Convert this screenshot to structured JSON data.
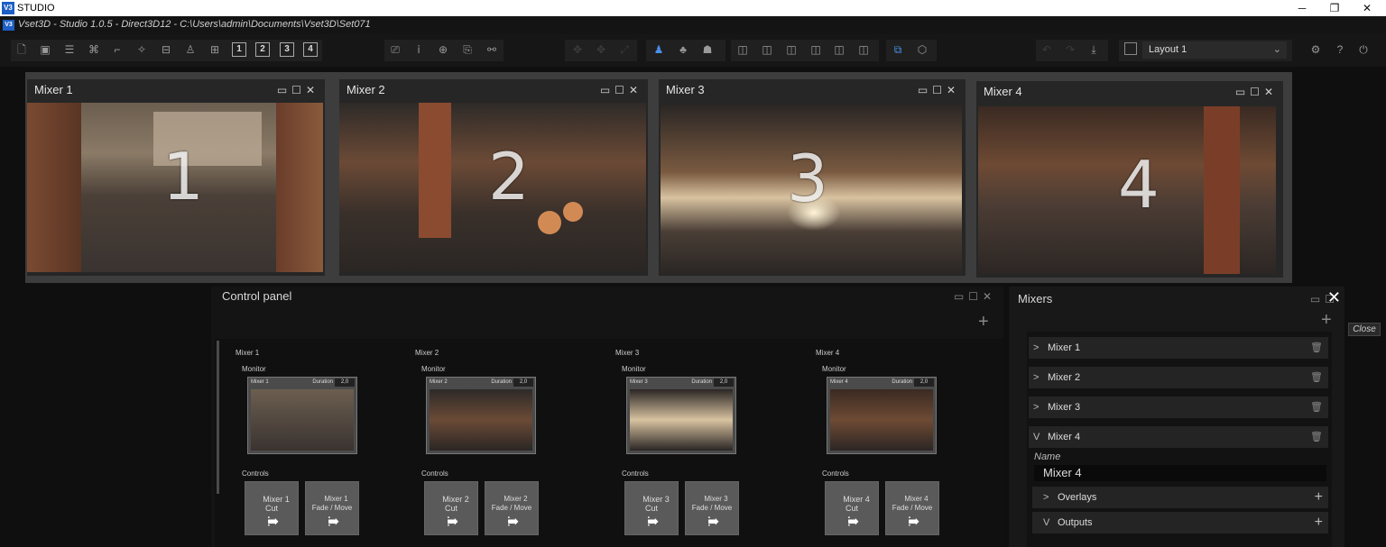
{
  "os_window": {
    "logo": "V3",
    "title": "STUDIO",
    "minimize": "─",
    "restore": "❐",
    "close": "✕"
  },
  "app": {
    "logo": "V3",
    "title": "Vset3D - Studio 1.0.5 - Direct3D12 - C:\\Users\\admin\\Documents\\Vset3D\\Set071"
  },
  "toolbar": {
    "layout_button": "Layout 1",
    "numbers": [
      "1",
      "2",
      "3",
      "4"
    ]
  },
  "mixer_windows": [
    {
      "title": "Mixer 1",
      "number": "1"
    },
    {
      "title": "Mixer 2",
      "number": "2"
    },
    {
      "title": "Mixer 3",
      "number": "3"
    },
    {
      "title": "Mixer 4",
      "number": "4"
    }
  ],
  "control_panel": {
    "title": "Control panel",
    "mixers": [
      {
        "name": "Mixer 1",
        "monitor_label": "Monitor",
        "monitor_name": "Mixer 1",
        "duration_label": "Duration",
        "duration": "2,0",
        "controls_label": "Controls",
        "cut": "Mixer 1\nCut",
        "fade": "Mixer 1\nFade / Move"
      },
      {
        "name": "Mixer 2",
        "monitor_label": "Monitor",
        "monitor_name": "Mixer 2",
        "duration_label": "Duration",
        "duration": "2,0",
        "controls_label": "Controls",
        "cut": "Mixer 2\nCut",
        "fade": "Mixer 2\nFade / Move"
      },
      {
        "name": "Mixer 3",
        "monitor_label": "Monitor",
        "monitor_name": "Mixer 3",
        "duration_label": "Duration",
        "duration": "2,0",
        "controls_label": "Controls",
        "cut": "Mixer 3\nCut",
        "fade": "Mixer 3\nFade / Move"
      },
      {
        "name": "Mixer 4",
        "monitor_label": "Monitor",
        "monitor_name": "Mixer 4",
        "duration_label": "Duration",
        "duration": "2,0",
        "controls_label": "Controls",
        "cut": "Mixer 4\nCut",
        "fade": "Mixer 4\nFade / Move"
      }
    ]
  },
  "mixers_panel": {
    "title": "Mixers",
    "tooltip": "Close",
    "items": [
      {
        "label": "Mixer 1",
        "caret": ">"
      },
      {
        "label": "Mixer 2",
        "caret": ">"
      },
      {
        "label": "Mixer 3",
        "caret": ">"
      },
      {
        "label": "Mixer 4",
        "caret": "V"
      }
    ],
    "name_label": "Name",
    "name_value": "Mixer 4",
    "overlays": "Overlays",
    "outputs": "Outputs"
  },
  "icons": [
    "new-file-icon",
    "image-icon",
    "hierarchy-icon",
    "transform-icon",
    "graph-icon",
    "sparkle-icon",
    "align-icon",
    "stack-icon",
    "grid-icon",
    "camera-icon",
    "info-icon",
    "globe-icon",
    "clipboard-icon",
    "link-icon",
    "user-icon",
    "group-icon",
    "cube-icon",
    "download-icon",
    "settings-icon",
    "help-icon",
    "power-icon"
  ]
}
